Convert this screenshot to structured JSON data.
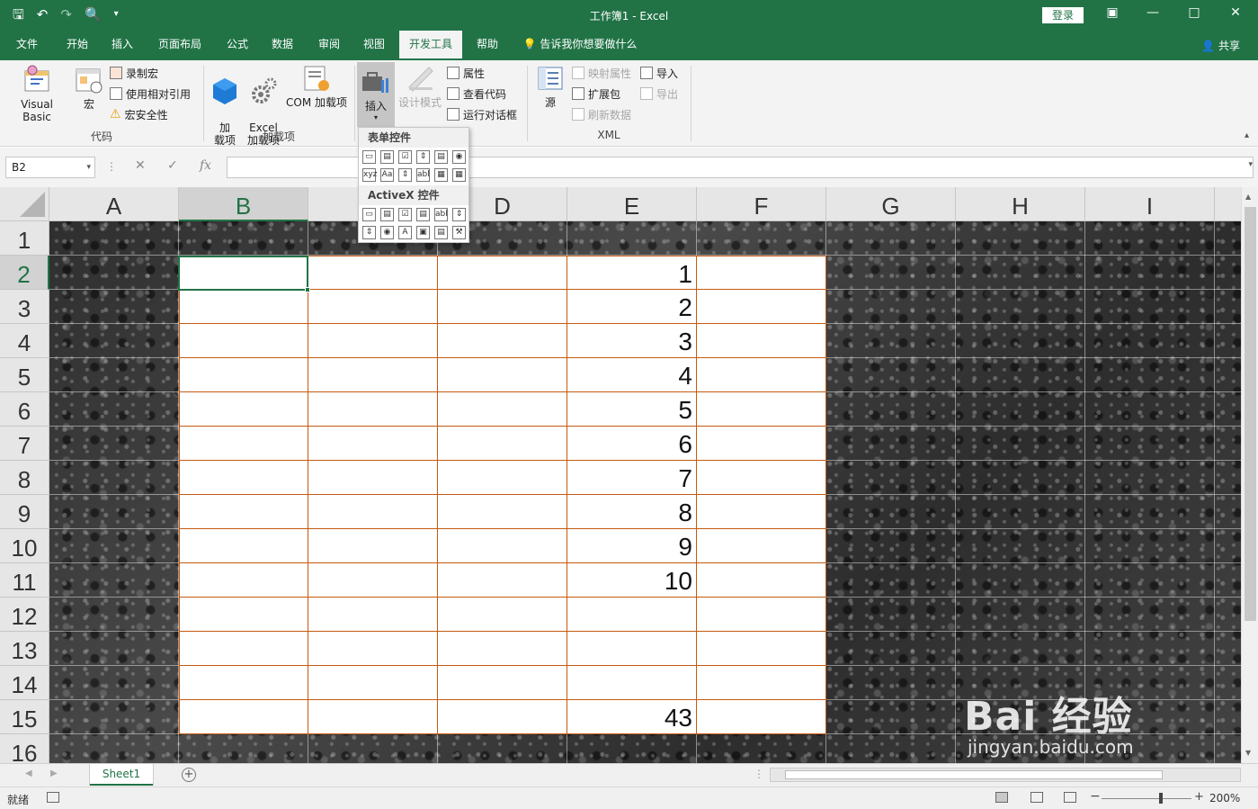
{
  "window": {
    "title": "工作簿1  -  Excel",
    "login": "登录",
    "qat_icons": [
      "save-icon",
      "undo-icon",
      "redo-icon",
      "print-preview-icon",
      "customize-qat-icon"
    ]
  },
  "tabs": [
    "文件",
    "开始",
    "插入",
    "页面布局",
    "公式",
    "数据",
    "审阅",
    "视图",
    "开发工具",
    "帮助"
  ],
  "active_tab": "开发工具",
  "tell_me": "告诉我你想要做什么",
  "share": "共享",
  "ribbon": {
    "code_group": {
      "label": "代码",
      "visual_basic": "Visual Basic",
      "macros": "宏",
      "record_macro": "录制宏",
      "relative_refs": "使用相对引用",
      "macro_security": "宏安全性"
    },
    "addins_group": {
      "label": "加载项",
      "addins": "加\n载项",
      "excel_addins": "Excel\n加载项",
      "com_addins": "COM 加载项"
    },
    "controls_group": {
      "insert": "插入",
      "design_mode": "设计模式",
      "properties": "属性",
      "view_code": "查看代码",
      "run_dialog": "运行对话框"
    },
    "xml_group": {
      "label": "XML",
      "source": "源",
      "map_properties": "映射属性",
      "expansion_packs": "扩展包",
      "refresh_data": "刷新数据",
      "import": "导入",
      "export": "导出"
    }
  },
  "dropdown": {
    "form_controls": "表单控件",
    "activex_controls": "ActiveX 控件",
    "form_row1": [
      "▭",
      "▤",
      "☑",
      "⇕",
      "▤",
      "◉"
    ],
    "form_row2": [
      "xyz",
      "Aa",
      "⇕",
      "abl",
      "▦",
      "▦"
    ],
    "ax_row1": [
      "▭",
      "▤",
      "☑",
      "▤",
      "abl",
      "⇕"
    ],
    "ax_row2": [
      "⇕",
      "◉",
      "A",
      "▣",
      "▤",
      "⚒"
    ]
  },
  "formula_bar": {
    "name_box": "B2",
    "fx": "fx",
    "formula": ""
  },
  "columns": [
    "A",
    "B",
    "C",
    "D",
    "E",
    "F",
    "G",
    "H",
    "I"
  ],
  "rows": [
    "1",
    "2",
    "3",
    "4",
    "5",
    "6",
    "7",
    "8",
    "9",
    "10",
    "11",
    "12",
    "13",
    "14",
    "15",
    "16"
  ],
  "selected_cell": "B2",
  "column_e_values": [
    "1",
    "2",
    "3",
    "4",
    "5",
    "6",
    "7",
    "8",
    "9",
    "10",
    "",
    "",
    "",
    "43"
  ],
  "sheet_tab": "Sheet1",
  "status": {
    "ready": "就绪",
    "zoom": "200%"
  },
  "watermark": {
    "brand": "Bai 经验",
    "url": "jingyan.baidu.com"
  },
  "colors": {
    "excel_green": "#217346",
    "table_border": "#c55a11"
  }
}
